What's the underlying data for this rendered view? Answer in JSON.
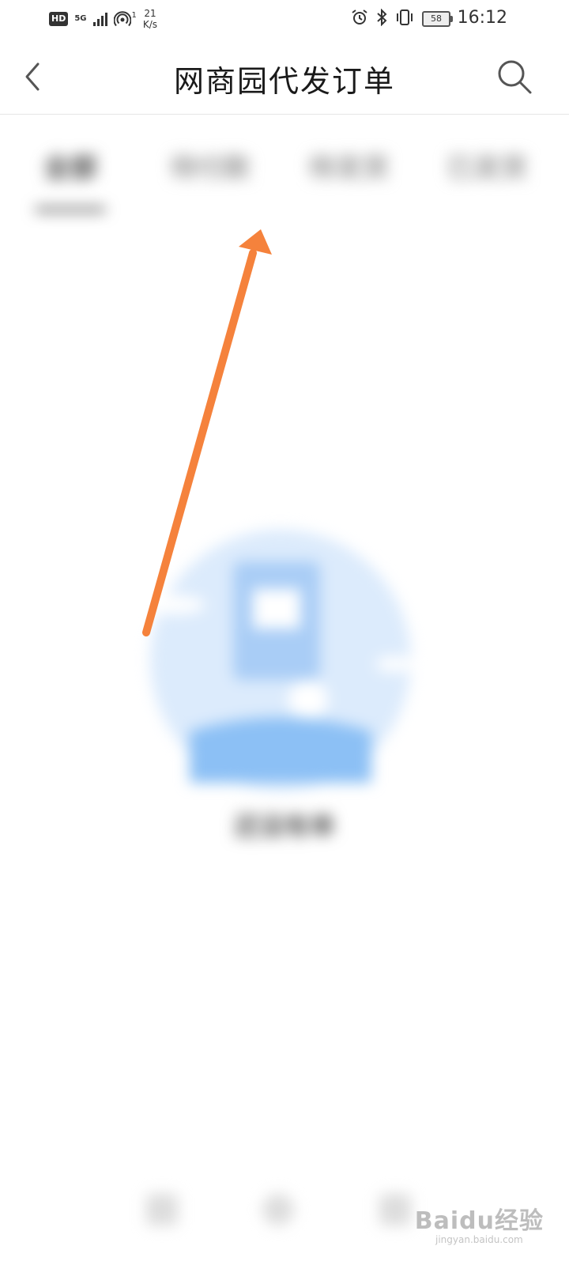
{
  "status_bar": {
    "hd": "HD",
    "network": "5G",
    "hotspot_count": "1",
    "speed_value": "21",
    "speed_unit": "K/s",
    "battery": "58",
    "time": "16:12"
  },
  "header": {
    "title": "网商园代发订单",
    "back_icon": "chevron-left-icon",
    "search_icon": "search-icon"
  },
  "tabs": [
    {
      "label": "全部",
      "active": true
    },
    {
      "label": "待付款",
      "active": false
    },
    {
      "label": "待发货",
      "active": false
    },
    {
      "label": "已发货",
      "active": false
    }
  ],
  "empty_state": {
    "text": "还没有单"
  },
  "annotation": {
    "color": "#f5823c"
  },
  "watermark": {
    "brand": "Baidu经验",
    "url": "jingyan.baidu.com"
  }
}
